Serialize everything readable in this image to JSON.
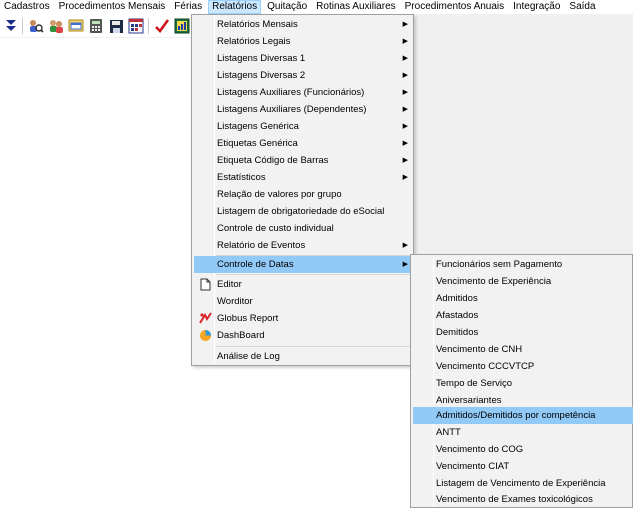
{
  "menubar": {
    "items": [
      "Cadastros",
      "Procedimentos Mensais",
      "Férias",
      "Relatórios",
      "Quitação",
      "Rotinas Auxiliares",
      "Procedimentos Anuais",
      "Integração",
      "Saída"
    ],
    "active_index": 3
  },
  "toolbar": {
    "icons": [
      "double-chevron-down-icon",
      "people-search-icon",
      "people-icon",
      "folder-window-icon",
      "calculator-icon",
      "floppy-save-icon",
      "calendar-grid-icon",
      "checkmark-icon",
      "chart-window-icon"
    ]
  },
  "relatorios_menu": {
    "items": [
      {
        "label": "Relatórios Mensais",
        "submenu": true
      },
      {
        "label": "Relatórios Legais",
        "submenu": true
      },
      {
        "label": "Listagens Diversas 1",
        "submenu": true
      },
      {
        "label": "Listagens Diversas 2",
        "submenu": true
      },
      {
        "label": "Listagens Auxiliares (Funcionários)",
        "submenu": true
      },
      {
        "label": "Listagens Auxiliares (Dependentes)",
        "submenu": true
      },
      {
        "label": "Listagens Genérica",
        "submenu": true
      },
      {
        "label": "Etiquetas Genérica",
        "submenu": true
      },
      {
        "label": "Etiqueta Código de Barras",
        "submenu": true
      },
      {
        "label": "Estatísticos",
        "submenu": true
      },
      {
        "label": "Relação de valores por grupo",
        "submenu": false
      },
      {
        "label": "Listagem de obrigatoriedade do eSocial",
        "submenu": false
      },
      {
        "label": "Controle de custo individual",
        "submenu": false
      },
      {
        "label": "Relatório de Eventos",
        "submenu": true
      },
      {
        "label": "Controle de Datas",
        "submenu": true,
        "highlighted": true
      },
      {
        "label": "Editor",
        "submenu": false,
        "icon": "document-icon"
      },
      {
        "label": "Worditor",
        "submenu": false
      },
      {
        "label": "Globus Report",
        "submenu": false,
        "icon": "globus-report-icon"
      },
      {
        "label": "DashBoard",
        "submenu": false,
        "icon": "pie-chart-icon"
      },
      {
        "label": "Análise de Log",
        "submenu": false
      }
    ]
  },
  "controle_datas_menu": {
    "items": [
      {
        "label": "Funcionários sem Pagamento"
      },
      {
        "label": "Vencimento de Experiência"
      },
      {
        "label": "Admitidos"
      },
      {
        "label": "Afastados"
      },
      {
        "label": "Demitidos"
      },
      {
        "label": "Vencimento de CNH"
      },
      {
        "label": "Vencimento CCCVTCP"
      },
      {
        "label": "Tempo de Serviço"
      },
      {
        "label": "Aniversariantes"
      },
      {
        "label": "Admitidos/Demitidos por competência",
        "highlighted": true
      },
      {
        "label": "ANTT"
      },
      {
        "label": "Vencimento do COG"
      },
      {
        "label": "Vencimento CIAT"
      },
      {
        "label": "Listagem de Vencimento de Experiência"
      },
      {
        "label": "Vencimento de Exames toxicológicos"
      }
    ]
  },
  "colors": {
    "menu_background": "#f2f2f2",
    "highlight": "#91c9f7",
    "menubar_active": "#cce8ff"
  }
}
